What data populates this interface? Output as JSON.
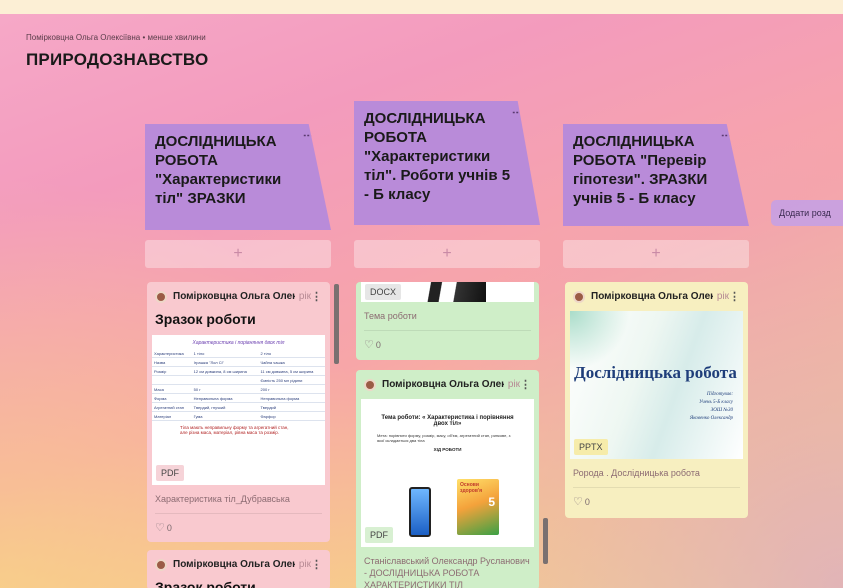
{
  "page": {
    "meta": "Помірковцна Ольга Олексіївна • менше хвилини",
    "title": "ПРИРОДОЗНАВСТВО"
  },
  "columns": [
    {
      "title": "ДОСЛІДНИЦЬКА РОБОТА \"Характеристики тіл\" ЗРАЗКИ",
      "menu": "⋮",
      "add": "+"
    },
    {
      "title": "ДОСЛІДНИЦЬКА РОБОТА \"Характеристики тіл\". Роботи учнів 5 - Б класу",
      "menu": "⋮",
      "add": "+"
    },
    {
      "title": "ДОСЛІДНИЦЬКА РОБОТА \"Перевір гіпотези\". ЗРАЗКИ учнів 5 - Б класу",
      "menu": "⋮",
      "add": "+"
    }
  ],
  "add_section": "Додати розд",
  "cards": {
    "c1": {
      "author": "Помірковцна Ольга Олексі...",
      "time": "рік",
      "title": "Зразок роботи",
      "thumb_heading": "Характеристика і порівняння двох тіл",
      "table_header": [
        "Характеристика",
        "1 тіло",
        "2 тіло"
      ],
      "table_rows": [
        [
          "Назва",
          "Іграшка \"Лол Сі\"",
          "Чайна чашка"
        ],
        [
          "Розмір",
          "12 см довжина, 8 см ширина",
          "11 см довжина, 5 см ширина"
        ],
        [
          "",
          "",
          "Ємність 250 мл рідини"
        ],
        [
          "Маса",
          "50 г",
          "200 г"
        ],
        [
          "Форма",
          "Неправильна форма",
          "Неправильна форма"
        ],
        [
          "Агрегатний стан",
          "Твердий, гнучкий",
          "Твердий"
        ],
        [
          "Матеріал",
          "Гума",
          "Фарфор"
        ]
      ],
      "thumb_note": "Тіла мають неправильну форму та агрегатний стан, але різна маса, матеріал, рівна маса та розмір.",
      "badge": "PDF",
      "subtitle": "Характеристика тіл_Дубравська",
      "likes": "0"
    },
    "c2": {
      "badge": "DOCX",
      "subtitle": "Тема роботи",
      "likes": "0"
    },
    "c3": {
      "author": "Помірковцна Ольга Олексі...",
      "time": "рік",
      "doc_title": "Тема роботи: « Характеристика і порівняння двох тіл»",
      "doc_goal": "Мета: порівняти форму, розмір, масу, об'єм, агрегатний стан, ринкове, з якої складається два тіла",
      "doc_section": "ХІД РОБОТИ",
      "book_label": "Основи здоров'я",
      "book_grade": "5",
      "badge": "PDF",
      "subtitle": "Станіславський Олександр Русланович - ДОСЛІДНИЦЬКА РОБОТА ХАРАКТЕРИСТИКИ ТІЛ"
    },
    "c4": {
      "author": "Помірковцна Ольга Олексі...",
      "time": "рік",
      "slide_title": "Дослідницька робота",
      "slide_lines": [
        "Підготував:",
        "Учень 5-Б класу",
        "ЗОШ №30",
        "Яковенко Олександр"
      ],
      "badge": "PPTX",
      "subtitle": "Ророда . Дослідницька робота",
      "likes": "0"
    },
    "c5": {
      "author": "Помірковцна Ольга Олексі...",
      "time": "рік",
      "title": "Зразок роботи"
    }
  },
  "colors": {
    "column_header": "#b98bd9",
    "card_pink": "#f9c9cf",
    "card_green": "#cfeec8",
    "card_yellow": "#f7efc0"
  }
}
